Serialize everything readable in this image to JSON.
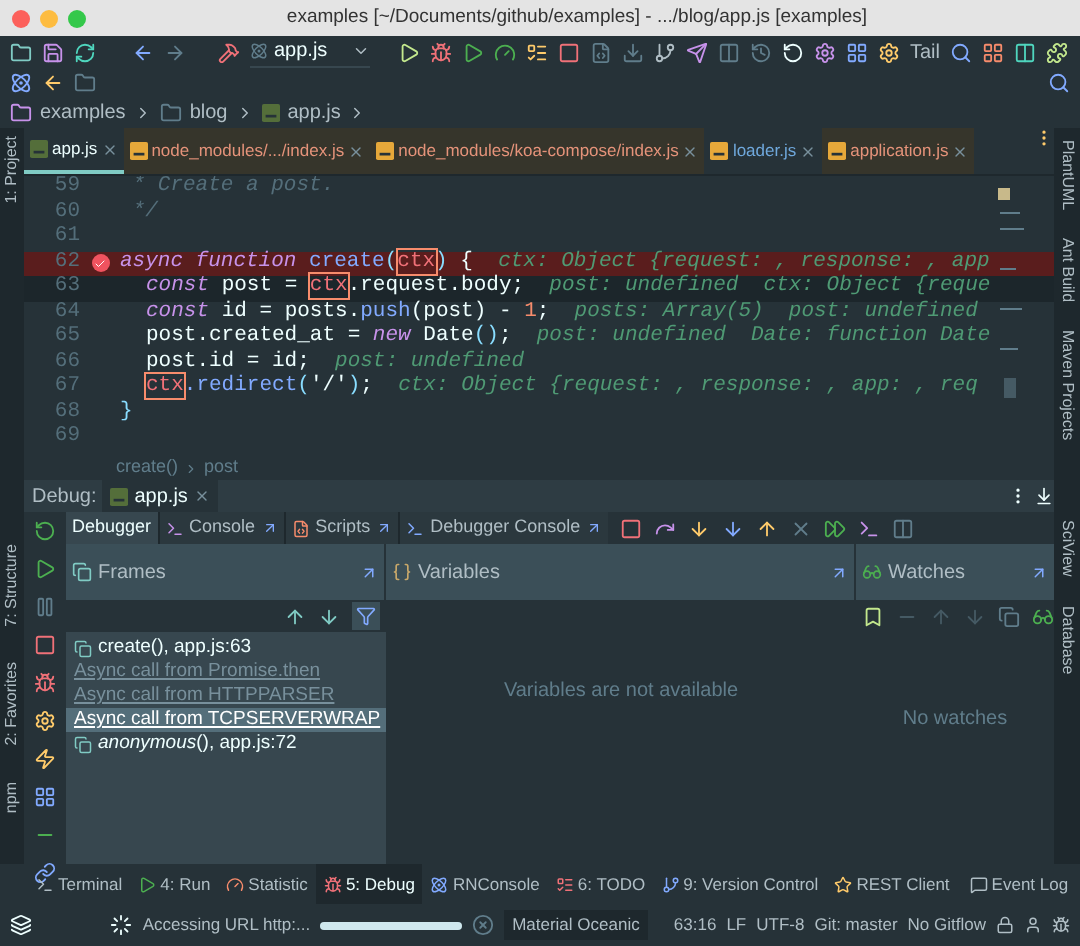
{
  "window": {
    "title": "examples [~/Documents/github/examples] - .../blog/app.js [examples]"
  },
  "toolbar": {
    "run_config": "app.js",
    "tail_label": "Tail"
  },
  "breadcrumb": [
    "examples",
    "blog",
    "app.js"
  ],
  "tabs": [
    {
      "label": "app.js",
      "selected": true,
      "kind": "project",
      "color": "#eeffff"
    },
    {
      "label": "node_modules/.../index.js",
      "selected": false,
      "kind": "library",
      "color": "#e5937a"
    },
    {
      "label": "node_modules/koa-compose/index.js",
      "selected": false,
      "kind": "library",
      "color": "#e5937a"
    },
    {
      "label": "loader.js",
      "selected": false,
      "kind": "project",
      "color": "#6fa8dc"
    },
    {
      "label": "application.js",
      "selected": false,
      "kind": "library",
      "color": "#e5937a"
    }
  ],
  "left_strip": [
    "1: Project",
    "7: Structure",
    "2: Favorites",
    "npm"
  ],
  "right_strip": [
    "PlantUML",
    "Ant Build",
    "Maven Projects",
    "SciView",
    "Database"
  ],
  "editor": {
    "lines": [
      {
        "number": "59",
        "kind": "plain",
        "breakpoint": false,
        "segments": [
          {
            "kind": "comment",
            "text": " * Create a post."
          }
        ]
      },
      {
        "number": "60",
        "kind": "plain",
        "breakpoint": false,
        "segments": [
          {
            "kind": "comment",
            "text": " */"
          }
        ]
      },
      {
        "number": "61",
        "kind": "plain",
        "breakpoint": false
      },
      {
        "number": "62",
        "kind": "breakpoint",
        "breakpoint": true,
        "segments": [
          {
            "kind": "kw",
            "text": "async function "
          },
          {
            "kind": "fn",
            "text": "create"
          },
          {
            "kind": "punct",
            "text": "("
          },
          {
            "kind": "ref",
            "text": "ctx"
          },
          {
            "kind": "punct",
            "text": ") "
          },
          {
            "kind": "txt",
            "text": "{  "
          },
          {
            "kind": "hint",
            "text": "ctx: Object {request: , response: , app"
          }
        ]
      },
      {
        "number": "63",
        "kind": "current",
        "breakpoint": false,
        "indented": true,
        "segments": [
          {
            "kind": "kw",
            "text": "const "
          },
          {
            "kind": "txt",
            "text": "post = "
          },
          {
            "kind": "ref",
            "text": "ctx"
          },
          {
            "kind": "txt",
            "text": ".request.body;  "
          },
          {
            "kind": "hint",
            "text": "post: undefined  ctx: Object {reque"
          }
        ]
      },
      {
        "number": "64",
        "kind": "plain",
        "breakpoint": false,
        "indented": true,
        "segments": [
          {
            "kind": "kw",
            "text": "const "
          },
          {
            "kind": "txt",
            "text": "id = posts."
          },
          {
            "kind": "fn",
            "text": "push"
          },
          {
            "kind": "txt",
            "text": "(post) - "
          },
          {
            "kind": "num",
            "text": "1"
          },
          {
            "kind": "txt",
            "text": ";  "
          },
          {
            "kind": "hint",
            "text": "posts: Array(5)  post: undefined"
          }
        ]
      },
      {
        "number": "65",
        "kind": "plain",
        "breakpoint": false,
        "indented": true,
        "segments": [
          {
            "kind": "txt",
            "text": "post.created_at = "
          },
          {
            "kind": "kw",
            "text": "new "
          },
          {
            "kind": "txt",
            "text": "Date"
          },
          {
            "kind": "punct",
            "text": "()"
          },
          {
            "kind": "txt",
            "text": ";  "
          },
          {
            "kind": "hint",
            "text": "post: undefined  Date: function Date"
          }
        ]
      },
      {
        "number": "66",
        "kind": "plain",
        "breakpoint": false,
        "indented": true,
        "segments": [
          {
            "kind": "txt",
            "text": "post.id = id;  "
          },
          {
            "kind": "hint",
            "text": "post: undefined"
          }
        ]
      },
      {
        "number": "67",
        "kind": "plain",
        "breakpoint": false,
        "indented": true,
        "segments": [
          {
            "kind": "ref",
            "text": "ctx"
          },
          {
            "kind": "fn",
            "text": ".redirect"
          },
          {
            "kind": "punct",
            "text": "("
          },
          {
            "kind": "txt",
            "text": "'/'"
          },
          {
            "kind": "punct",
            "text": ")"
          },
          {
            "kind": "txt",
            "text": ";  "
          },
          {
            "kind": "hint",
            "text": "ctx: Object {request: , response: , app: , req"
          }
        ]
      },
      {
        "number": "68",
        "kind": "plain",
        "breakpoint": false,
        "segments": [
          {
            "kind": "punct",
            "text": "}"
          }
        ]
      },
      {
        "number": "69",
        "kind": "plain",
        "breakpoint": false
      }
    ],
    "crumbs": [
      "create()",
      "post"
    ]
  },
  "debug": {
    "label": "Debug:",
    "session": "app.js",
    "tabs": [
      {
        "label": "Debugger",
        "selected": true
      },
      {
        "label": "Console",
        "selected": false
      },
      {
        "label": "Scripts",
        "selected": false
      },
      {
        "label": "Debugger Console",
        "selected": false
      }
    ],
    "panels": {
      "frames": "Frames",
      "variables": "Variables",
      "watches": "Watches"
    },
    "frames": [
      {
        "kind": "frame",
        "text": "create(), app.js:63",
        "selected": false
      },
      {
        "kind": "async",
        "text": "Async call from Promise.then",
        "selected": false
      },
      {
        "kind": "async",
        "text": "Async call from HTTPPARSER",
        "selected": false
      },
      {
        "kind": "async",
        "text": "Async call from TCPSERVERWRAP",
        "selected": true
      },
      {
        "kind": "frame",
        "text": "*anonymous*(), app.js:72",
        "selected": false
      }
    ],
    "variables_empty": "Variables are not available",
    "watches_empty": "No watches"
  },
  "tool_windows": [
    {
      "label": "Terminal",
      "selected": false
    },
    {
      "label": "4: Run",
      "selected": false
    },
    {
      "label": "Statistic",
      "selected": false
    },
    {
      "label": "5: Debug",
      "selected": true
    },
    {
      "label": "RNConsole",
      "selected": false
    },
    {
      "label": "6: TODO",
      "selected": false
    },
    {
      "label": "9: Version Control",
      "selected": false
    },
    {
      "label": "REST Client",
      "selected": false
    }
  ],
  "event_log": "Event Log",
  "status_bar": {
    "task": "Accessing URL http:...",
    "level": 1,
    "theme": "Material Oceanic",
    "position": "63:16",
    "line_sep": "LF",
    "encoding": "UTF-8",
    "vcs": "Git: master",
    "gitflow": "No Gitflow"
  }
}
